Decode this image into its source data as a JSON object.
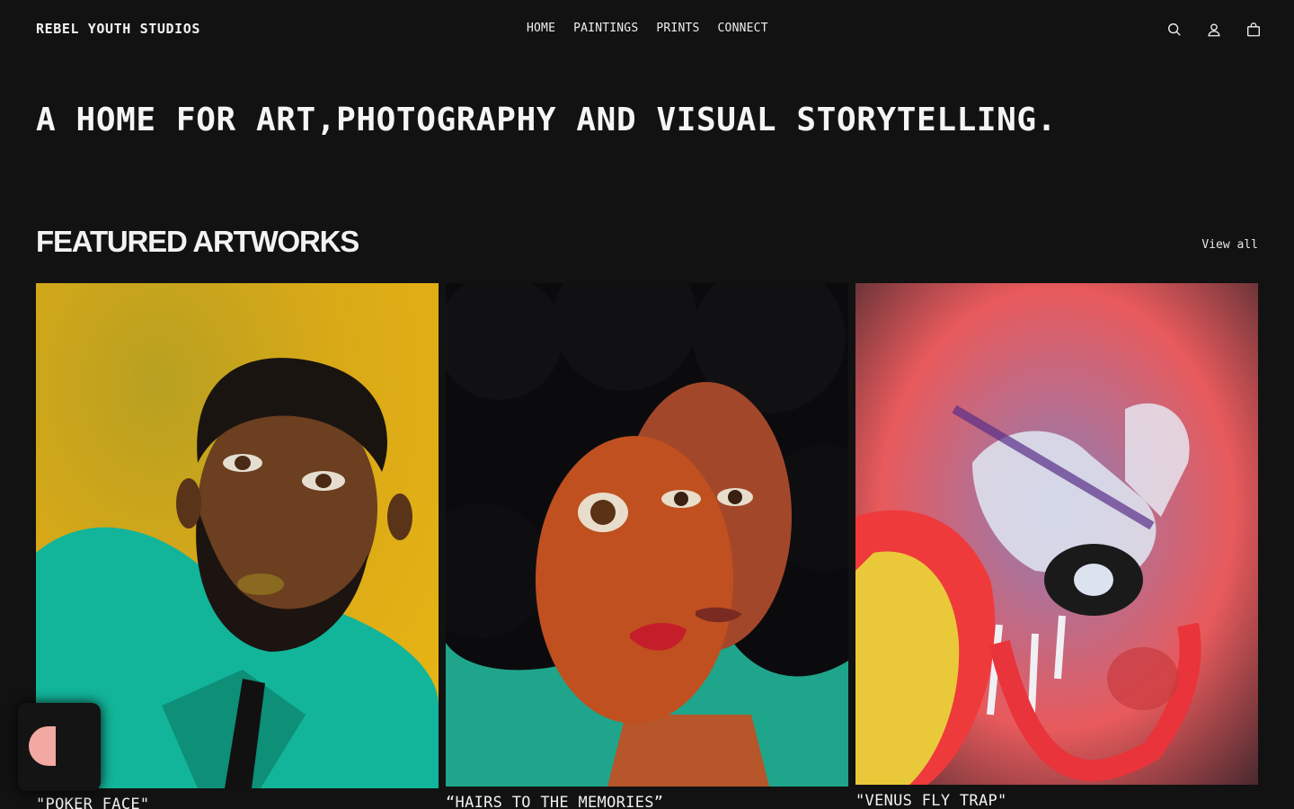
{
  "header": {
    "brand": "REBEL YOUTH STUDIOS",
    "nav": [
      "HOME",
      "PAINTINGS",
      "PRINTS",
      "CONNECT"
    ],
    "icons": [
      "search-icon",
      "account-icon",
      "cart-icon"
    ]
  },
  "hero": {
    "headline": "A HOME FOR ART,PHOTOGRAPHY AND VISUAL STORYTELLING."
  },
  "featured": {
    "title": "FEATURED ARTWORKS",
    "view_all": "View all",
    "items": [
      {
        "caption": "\"POKER FACE\""
      },
      {
        "caption": "“HAIRS TO THE MEMORIES”"
      },
      {
        "caption": "\"VENUS FLY TRAP\""
      }
    ]
  },
  "colors": {
    "background": "#121212",
    "text": "#f2f2f2",
    "accent_chat": "#f2a9a1"
  }
}
